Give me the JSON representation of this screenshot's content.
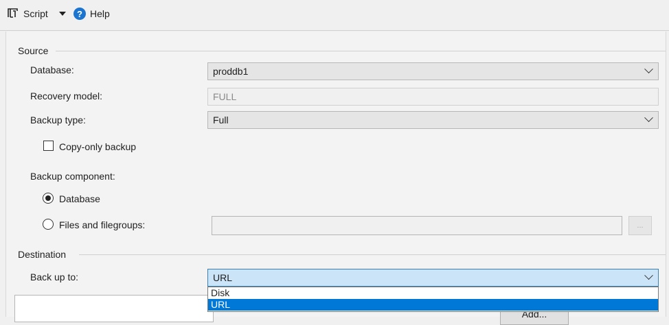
{
  "toolbar": {
    "script_label": "Script",
    "help_label": "Help"
  },
  "source": {
    "title": "Source",
    "database_label": "Database:",
    "database_value": "proddb1",
    "recovery_label": "Recovery model:",
    "recovery_value": "FULL",
    "backup_type_label": "Backup type:",
    "backup_type_value": "Full",
    "copy_only_label": "Copy-only backup",
    "copy_only_checked": false,
    "component_label": "Backup component:",
    "component_options": [
      {
        "label": "Database",
        "selected": true
      },
      {
        "label": "Files and filegroups:",
        "selected": false
      }
    ],
    "files_browse_label": "..."
  },
  "destination": {
    "title": "Destination",
    "backup_to_label": "Back up to:",
    "backup_to_value": "URL",
    "backup_to_options": [
      {
        "label": "Disk",
        "selected": false
      },
      {
        "label": "URL",
        "selected": true
      }
    ],
    "add_button_label": "Add..."
  },
  "colors": {
    "accent": "#0078d7",
    "active_combo": "#cce4f7"
  }
}
